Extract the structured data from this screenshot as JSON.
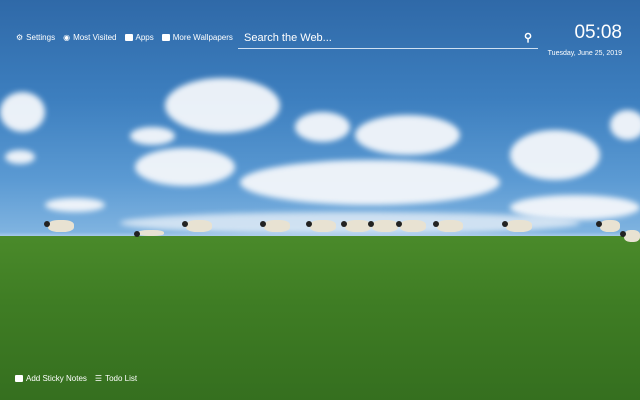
{
  "nav": {
    "settings": "Settings",
    "most_visited": "Most Visited",
    "apps": "Apps",
    "more_wallpapers": "More Wallpapers"
  },
  "search": {
    "placeholder": "Search the Web..."
  },
  "clock": {
    "time": "05:08",
    "date": "Tuesday, June 25, 2019"
  },
  "bottom": {
    "sticky": "Add Sticky Notes",
    "todo": "Todo List"
  }
}
